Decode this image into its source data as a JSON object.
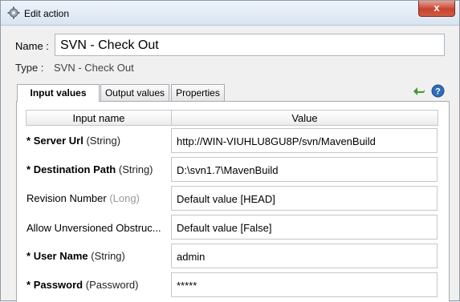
{
  "window": {
    "title": "Edit action",
    "close_label": "x"
  },
  "form": {
    "name_label": "Name :",
    "name_value": "SVN - Check Out",
    "type_label": "Type :",
    "type_value": "SVN - Check Out"
  },
  "tabs": [
    {
      "label": "Input values",
      "active": true
    },
    {
      "label": "Output values",
      "active": false
    },
    {
      "label": "Properties",
      "active": false
    }
  ],
  "table": {
    "headers": [
      "Input name",
      "Value"
    ],
    "rows": [
      {
        "required": "*",
        "name": "Server Url",
        "type": "(String)",
        "value": "http://WIN-VIUHLU8GU8P/svn/MavenBuild"
      },
      {
        "required": "*",
        "name": "Destination Path",
        "type": "(String)",
        "value": "D:\\svn1.7\\MavenBuild"
      },
      {
        "required": "",
        "name": "Revision Number",
        "type": "(Long)",
        "value": "Default value [HEAD]"
      },
      {
        "required": "",
        "name": "Allow Unversioned Obstruc...",
        "type": "",
        "value": "Default value [False]"
      },
      {
        "required": "*",
        "name": "User Name",
        "type": "(String)",
        "value": "admin"
      },
      {
        "required": "*",
        "name": "Password",
        "type": "(Password)",
        "value": "*****"
      }
    ]
  },
  "icons": {
    "title": "gear-icon",
    "back": "back-arrow-icon",
    "help": "help-icon"
  },
  "colors": {
    "back_arrow": "#3c9a2e",
    "help": "#2f6db8",
    "close": "#c7442f"
  }
}
